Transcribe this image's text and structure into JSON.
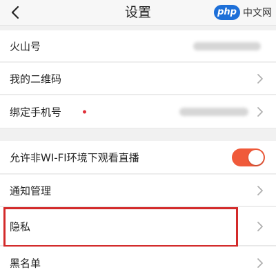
{
  "header": {
    "title": "设置",
    "back_icon": "chevron-left-icon",
    "watermark": {
      "logo_text": "php",
      "text": "中文网",
      "logo_color": "#1d6fd8"
    }
  },
  "rows": {
    "huoshan_id": {
      "label": "火山号",
      "value_hidden": true
    },
    "qr_code": {
      "label": "我的二维码"
    },
    "bind_phone": {
      "label": "绑定手机号",
      "indicator": "red-dot",
      "value_hidden": true
    },
    "wifi_live": {
      "label": "允许非WI-FI环境下观看直播",
      "toggle_on": true,
      "toggle_color": "#f05a3a"
    },
    "notifications": {
      "label": "通知管理"
    },
    "privacy": {
      "label": "隐私",
      "highlighted": true,
      "highlight_color": "#d32a2a"
    },
    "blacklist": {
      "label": "黑名单"
    }
  }
}
